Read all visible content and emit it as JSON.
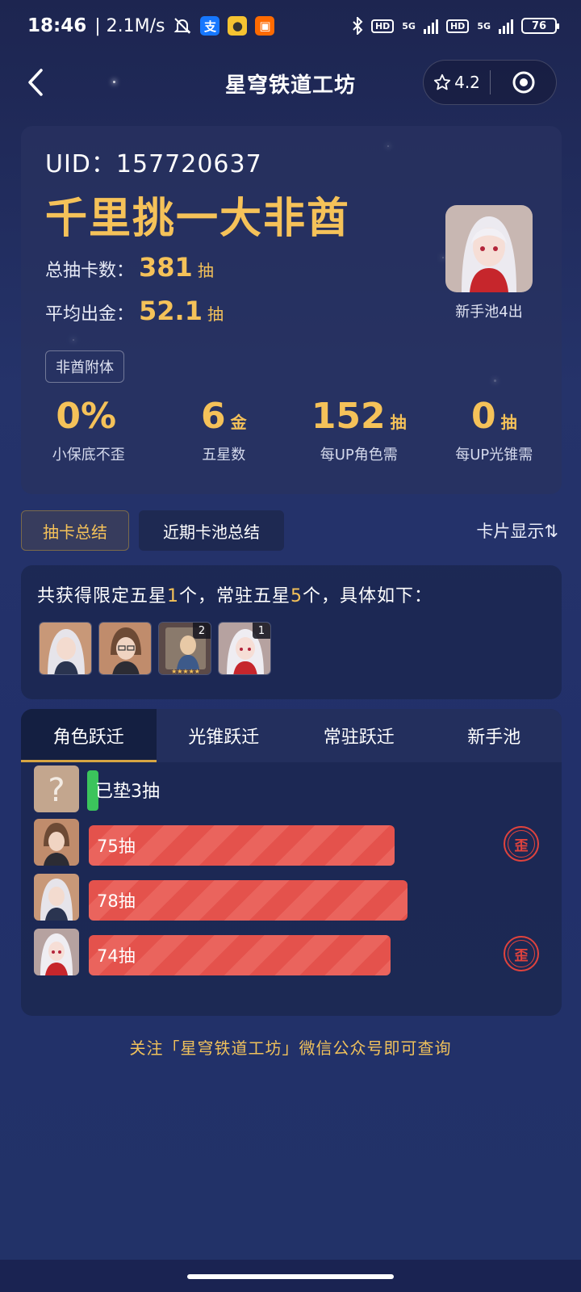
{
  "status_bar": {
    "time": "18:46",
    "net_speed": "| 2.1M/s",
    "app_icons": [
      "mute-bell-icon",
      "alipay-icon",
      "app-icon",
      "shopping-icon"
    ],
    "signal_labels": [
      "HD",
      "5G",
      "HD",
      "5G"
    ],
    "battery": "76"
  },
  "nav": {
    "title": "星穹铁道工坊",
    "rating": "4.2"
  },
  "summary": {
    "uid_label": "UID：",
    "uid_value": "157720637",
    "rank_title": "千里挑一大非酋",
    "total_label": "总抽卡数：",
    "total_value": "381",
    "total_unit": "抽",
    "avg_label": "平均出金：",
    "avg_value": "52.1",
    "avg_unit": "抽",
    "tag": "非酋附体",
    "avatar_caption": "新手池4出",
    "metrics": [
      {
        "value": "0%",
        "unit": "",
        "label": "小保底不歪"
      },
      {
        "value": "6",
        "unit": "金",
        "label": "五星数"
      },
      {
        "value": "152",
        "unit": "抽",
        "label": "每UP角色需"
      },
      {
        "value": "0",
        "unit": "抽",
        "label": "每UP光锥需"
      }
    ]
  },
  "view_tabs": {
    "summary": "抽卡总结",
    "recent": "近期卡池总结",
    "card_mode": "卡片显示⇅"
  },
  "five_star": {
    "prefix": "共获得限定五星",
    "limited": "1",
    "mid": "个，常驻五星",
    "standard": "5",
    "suffix": "个，具体如下：",
    "thumbs": [
      {
        "name": "character-white-hair-thumb",
        "count": ""
      },
      {
        "name": "character-brown-hair-thumb",
        "count": ""
      },
      {
        "name": "light-cone-thumb",
        "count": "2"
      },
      {
        "name": "character-red-coat-thumb",
        "count": "1"
      }
    ]
  },
  "warp_tabs": [
    "角色跃迁",
    "光锥跃迁",
    "常驻跃迁",
    "新手池"
  ],
  "warp_rows": {
    "pity": {
      "label": "已垫3抽",
      "pulls": 3
    },
    "items": [
      {
        "label": "75抽",
        "pulls": 75,
        "lost": true,
        "badge": "歪"
      },
      {
        "label": "78抽",
        "pulls": 78,
        "lost": false,
        "badge": ""
      },
      {
        "label": "74抽",
        "pulls": 74,
        "lost": true,
        "badge": "歪"
      }
    ]
  },
  "footer": "关注「星穹铁道工坊」微信公众号即可查询",
  "colors": {
    "gold": "#f5c259",
    "bar_red": "#e4524c",
    "pity_green": "#3bc45c",
    "badge_red": "#e0433d"
  }
}
